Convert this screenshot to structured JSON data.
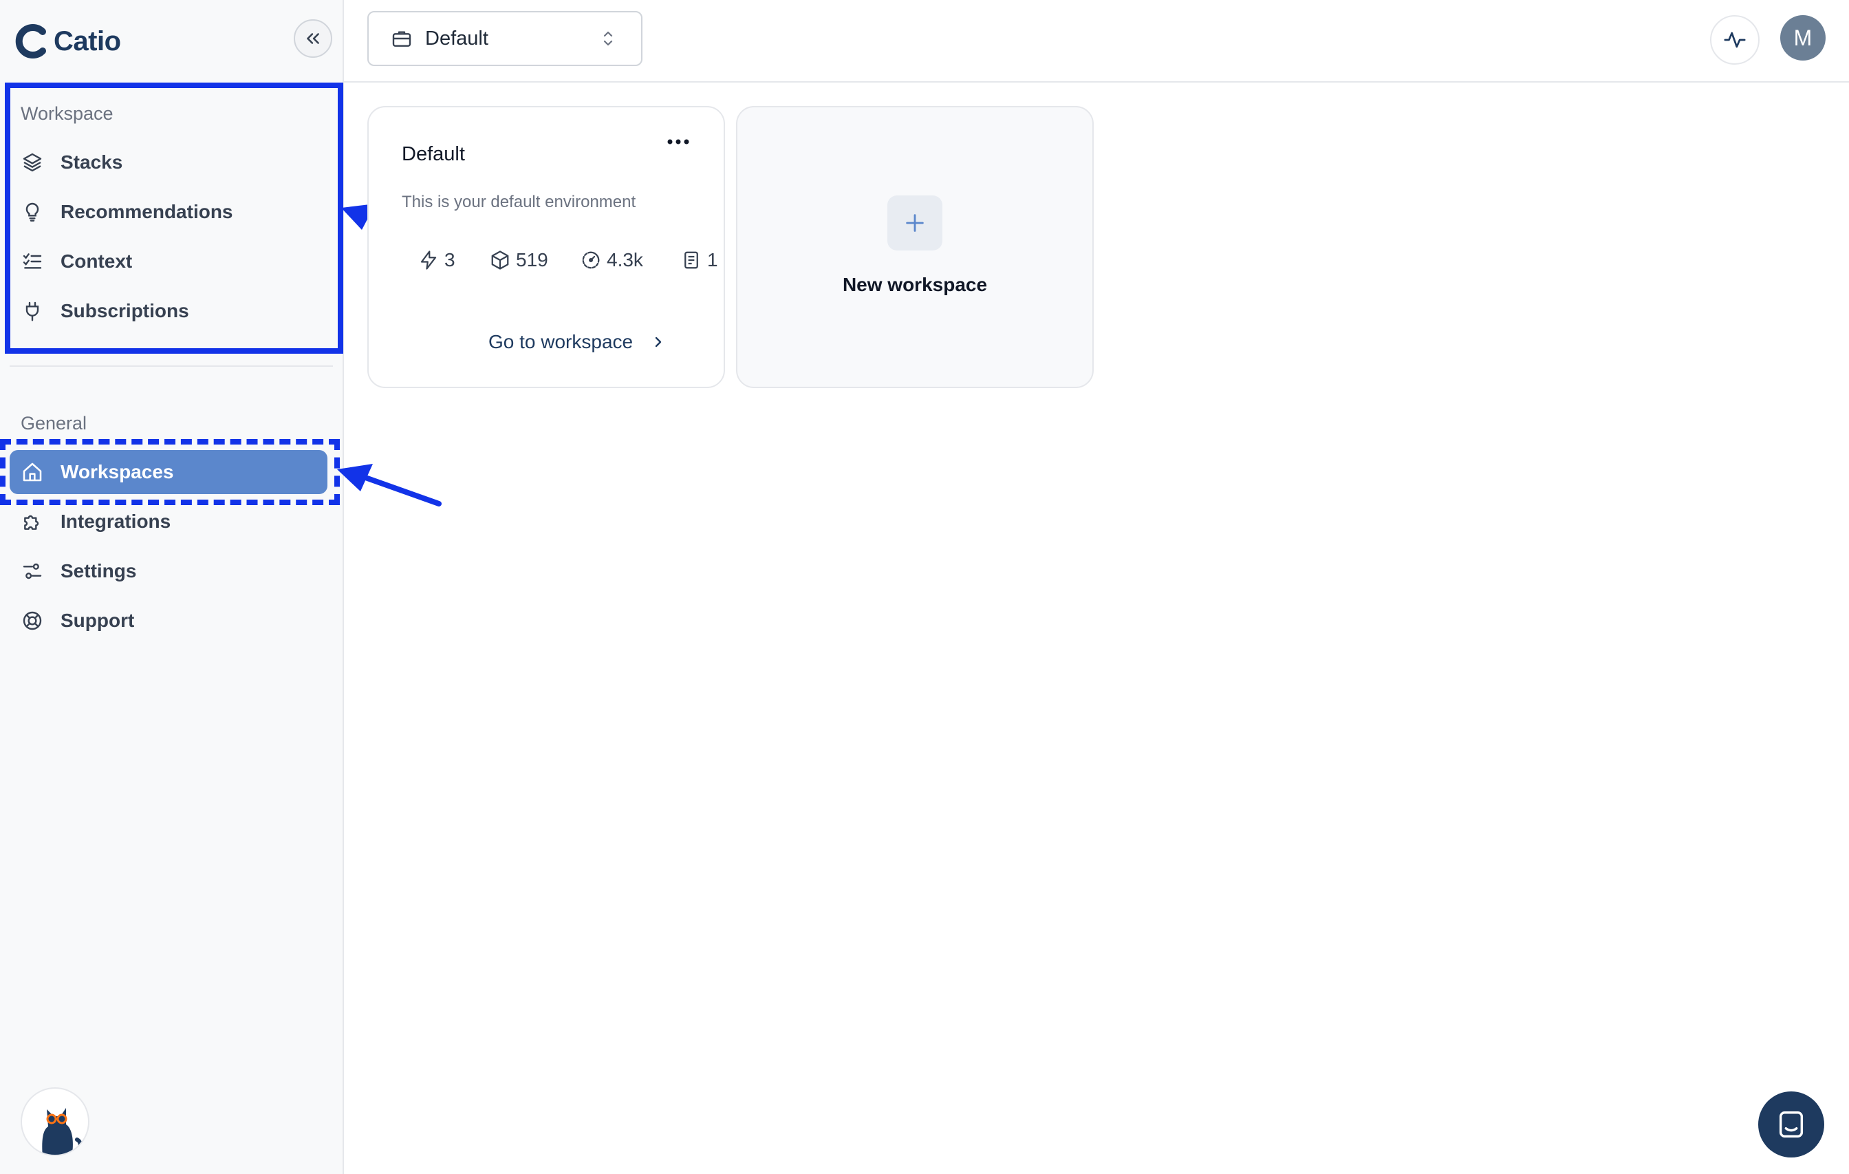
{
  "app": {
    "name": "Catio"
  },
  "sidebar": {
    "workspace_label": "Workspace",
    "workspace_items": [
      {
        "label": "Stacks",
        "icon": "layers-icon"
      },
      {
        "label": "Recommendations",
        "icon": "lightbulb-icon"
      },
      {
        "label": "Context",
        "icon": "checklist-icon"
      },
      {
        "label": "Subscriptions",
        "icon": "plug-icon"
      }
    ],
    "general_label": "General",
    "general_items": [
      {
        "label": "Workspaces",
        "icon": "home-icon",
        "active": true
      },
      {
        "label": "Integrations",
        "icon": "puzzle-icon"
      },
      {
        "label": "Settings",
        "icon": "sliders-icon"
      },
      {
        "label": "Support",
        "icon": "lifebuoy-icon"
      }
    ]
  },
  "topbar": {
    "workspace_select": "Default",
    "avatar_initial": "M"
  },
  "cards": {
    "workspace": {
      "title": "Default",
      "description": "This is your default environment",
      "stats": [
        {
          "icon": "bolt-icon",
          "value": "3"
        },
        {
          "icon": "cube-icon",
          "value": "519"
        },
        {
          "icon": "gauge-icon",
          "value": "4.3k"
        },
        {
          "icon": "document-icon",
          "value": "1"
        }
      ],
      "goto_label": "Go to workspace"
    },
    "new_workspace": {
      "label": "New workspace"
    }
  },
  "colors": {
    "brand": "#1e3a5f",
    "active_nav": "#5b87cc",
    "annotation": "#1233e8"
  }
}
